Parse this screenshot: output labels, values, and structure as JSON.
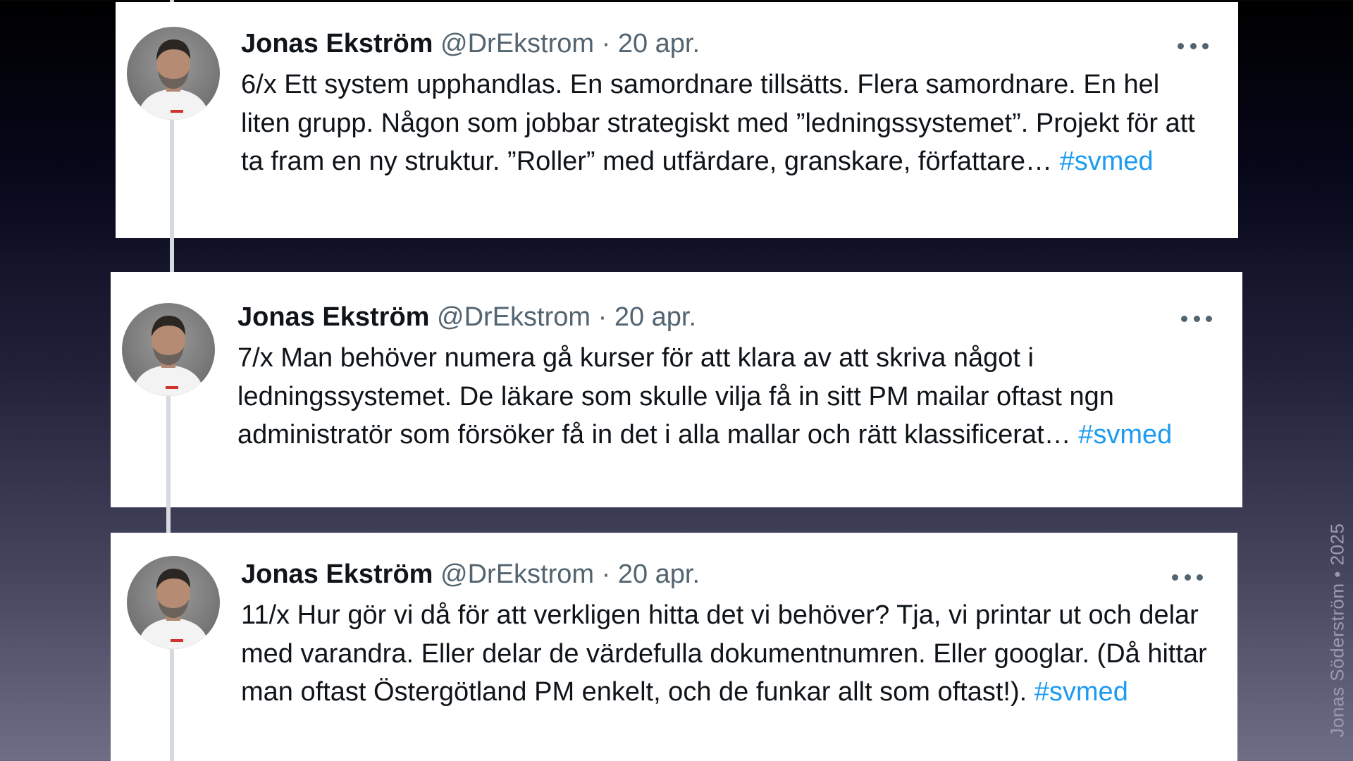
{
  "tweets": [
    {
      "name": "Jonas Ekström",
      "handle": "@DrEkstrom",
      "separator": "·",
      "date": "20 apr.",
      "text": "6/x Ett system upphandlas. En samordnare tillsätts. Flera samordnare. En hel liten grupp. Någon som jobbar strategiskt med ”ledningssystemet”. Projekt för att ta fram en ny struktur. ”Roller” med utfärdare, granskare, författare…",
      "hashtag": "#svmed"
    },
    {
      "name": "Jonas Ekström",
      "handle": "@DrEkstrom",
      "separator": "·",
      "date": "20 apr.",
      "text": "7/x Man behöver numera gå kurser för att klara av att skriva något i ledningssystemet. De läkare som skulle vilja få in sitt PM mailar oftast ngn administratör som försöker få in det i alla mallar och rätt klassificerat…",
      "hashtag": "#svmed"
    },
    {
      "name": "Jonas Ekström",
      "handle": "@DrEkstrom",
      "separator": "·",
      "date": "20 apr.",
      "text": "11/x Hur gör vi då för att verkligen hitta det vi behöver? Tja, vi printar ut och delar med varandra. Eller delar de värdefulla dokumentnumren. Eller googlar. (Då hittar man oftast Östergötland PM enkelt, och de funkar allt som oftast!).",
      "hashtag": "#svmed"
    }
  ],
  "watermark": "Jonas Söderström • 2025",
  "icons": {
    "avatar": "avatar-photo-icon",
    "more": "more-options-icon"
  },
  "colors": {
    "hashtag": "#1d9bf0",
    "secondary_text": "#536471",
    "primary_text": "#0f1419",
    "thread_line": "#d5dadf"
  }
}
